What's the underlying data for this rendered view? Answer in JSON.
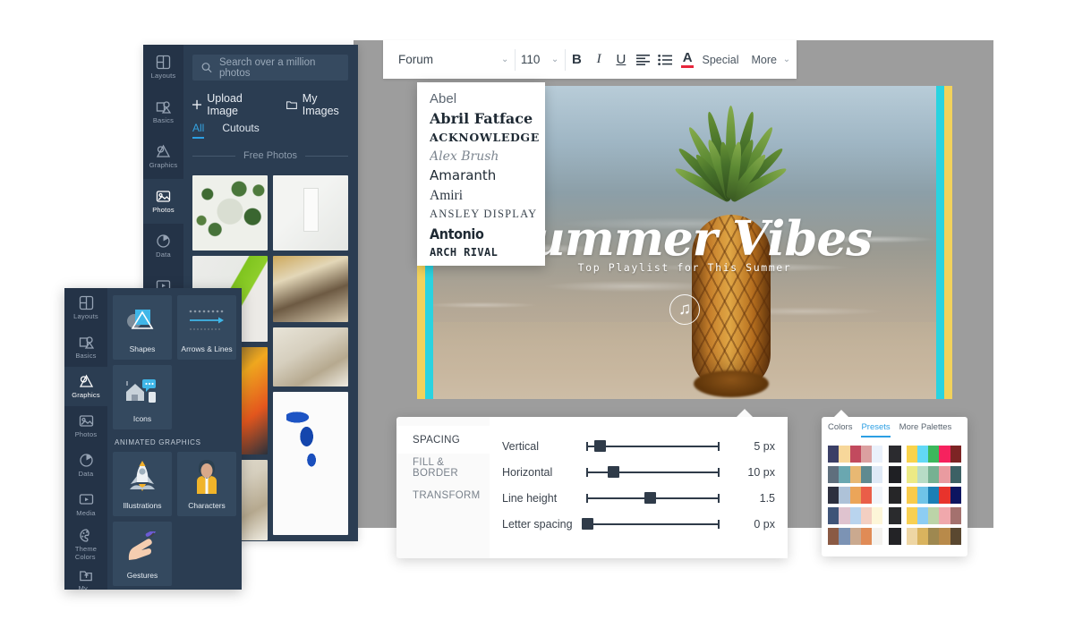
{
  "toolbar": {
    "font_name": "Forum",
    "font_size": "110",
    "bold_label": "B",
    "italic_label": "I",
    "underline_label": "U",
    "align_icon": "align-left-icon",
    "list_icon": "bullet-list-icon",
    "text_color_label": "A",
    "text_color": "#e8263c",
    "special_label": "Special",
    "more_label": "More",
    "caret_glyph": "⌄"
  },
  "font_dropdown": {
    "items": [
      {
        "label": "Abel",
        "style": "abel"
      },
      {
        "label": "Abril Fatface",
        "style": "abril"
      },
      {
        "label": "ACKNOWLEDGE",
        "style": "acknowledge"
      },
      {
        "label": "Alex Brush",
        "style": "alex"
      },
      {
        "label": "Amaranth",
        "style": "amaranth"
      },
      {
        "label": "Amiri",
        "style": "amiri"
      },
      {
        "label": "ANSLEY DISPLAY",
        "style": "ansley"
      },
      {
        "label": "Antonio",
        "style": "antonio"
      },
      {
        "label": "ARCH RIVAL",
        "style": "arch"
      }
    ]
  },
  "canvas": {
    "headline": "Summer Vibes",
    "subhead": "Top Playlist for This Summer",
    "note_icon": "music-note-icon",
    "note_glyph": "♫",
    "stripe_yellow": "#f2d25b",
    "stripe_cyan": "#2ad3e0"
  },
  "photos_panel": {
    "search": {
      "placeholder": "Search over a million photos",
      "icon": "search-icon"
    },
    "upload_label": "Upload Image",
    "upload_icon": "plus-icon",
    "my_images_label": "My Images",
    "my_images_icon": "folder-icon",
    "tabs": [
      {
        "label": "All",
        "active": true
      },
      {
        "label": "Cutouts",
        "active": false
      }
    ],
    "section_label": "Free Photos",
    "rail": [
      {
        "label": "Layouts",
        "icon": "layouts-icon",
        "active": false
      },
      {
        "label": "Basics",
        "icon": "basics-icon",
        "active": false
      },
      {
        "label": "Graphics",
        "icon": "graphics-icon",
        "active": false
      },
      {
        "label": "Photos",
        "icon": "photos-icon",
        "active": true
      },
      {
        "label": "Data",
        "icon": "data-icon",
        "active": false
      },
      {
        "label": "Media",
        "icon": "media-icon",
        "active": false
      }
    ]
  },
  "graphics_panel": {
    "rail": [
      {
        "label": "Layouts",
        "icon": "layouts-icon",
        "active": false
      },
      {
        "label": "Basics",
        "icon": "basics-icon",
        "active": false
      },
      {
        "label": "Graphics",
        "icon": "graphics-icon",
        "active": true
      },
      {
        "label": "Photos",
        "icon": "photos-icon",
        "active": false
      },
      {
        "label": "Data",
        "icon": "data-icon",
        "active": false
      },
      {
        "label": "Media",
        "icon": "media-icon",
        "active": false
      },
      {
        "label": "Theme Colors",
        "icon": "palette-icon",
        "active": false
      },
      {
        "label": "My Files",
        "icon": "my-files-icon",
        "active": false
      }
    ],
    "cards": [
      {
        "label": "Shapes",
        "icon": "shapes-icon"
      },
      {
        "label": "Arrows & Lines",
        "icon": "arrows-lines-icon"
      },
      {
        "label": "Icons",
        "icon": "icons-icon"
      }
    ],
    "section_label": "ANIMATED GRAPHICS",
    "animated_cards": [
      {
        "label": "Illustrations",
        "icon": "rocket-icon"
      },
      {
        "label": "Characters",
        "icon": "character-icon"
      },
      {
        "label": "Gestures",
        "icon": "hand-icon"
      }
    ]
  },
  "spacing_panel": {
    "tabs": [
      {
        "label": "SPACING",
        "active": true
      },
      {
        "label": "FILL & BORDER",
        "active": false
      },
      {
        "label": "TRANSFORM",
        "active": false
      }
    ],
    "rows": [
      {
        "name": "Vertical",
        "value": "5 px",
        "pos": 10
      },
      {
        "name": "Horizontal",
        "value": "10 px",
        "pos": 20
      },
      {
        "name": "Line height",
        "value": "1.5",
        "pos": 48
      },
      {
        "name": "Letter spacing",
        "value": "0 px",
        "pos": 1
      }
    ]
  },
  "colors_panel": {
    "tabs": [
      {
        "label": "Colors",
        "active": false
      },
      {
        "label": "Presets",
        "active": true
      },
      {
        "label": "More Palettes",
        "active": false
      }
    ],
    "rows": [
      {
        "main": [
          "#3b3f66",
          "#f7d79a",
          "#c24a5e",
          "#dba0a0",
          "#eaf1fb"
        ],
        "mini": [
          "#2b2b2f"
        ],
        "right": [
          "#f9d34b",
          "#62d8f6",
          "#3cb85c",
          "#f6225e",
          "#7d2424"
        ]
      },
      {
        "main": [
          "#5f6f7d",
          "#6aa7b0",
          "#e8b873",
          "#5f8a90",
          "#dfe9f6"
        ],
        "mini": [
          "#1f2024"
        ],
        "right": [
          "#ecea85",
          "#b7dcc6",
          "#76b192",
          "#e99ba0",
          "#3d6165"
        ]
      },
      {
        "main": [
          "#2c2f3e",
          "#aec2d8",
          "#eba559",
          "#ea5e48",
          "#f1f5fa"
        ],
        "mini": [
          "#262628"
        ],
        "right": [
          "#f8cb4b",
          "#6fc4e8",
          "#1a7fb5",
          "#e8332c",
          "#0c1560"
        ]
      },
      {
        "main": [
          "#3f5478",
          "#dfc3cf",
          "#b9d4ee",
          "#f3cfc2",
          "#fdf6d8"
        ],
        "mini": [
          "#2a2b2d"
        ],
        "right": [
          "#f8d052",
          "#8dcdf3",
          "#bcd4a8",
          "#f0a8ac",
          "#a4716e"
        ]
      },
      {
        "main": [
          "#8a5a44",
          "#7c93b4",
          "#caa98f",
          "#e08b56",
          "#f4f2ee"
        ],
        "mini": [
          "#232326"
        ],
        "right": [
          "#eed6a4",
          "#d9b35e",
          "#9e8850",
          "#b88a4a",
          "#5a4830"
        ]
      }
    ]
  }
}
